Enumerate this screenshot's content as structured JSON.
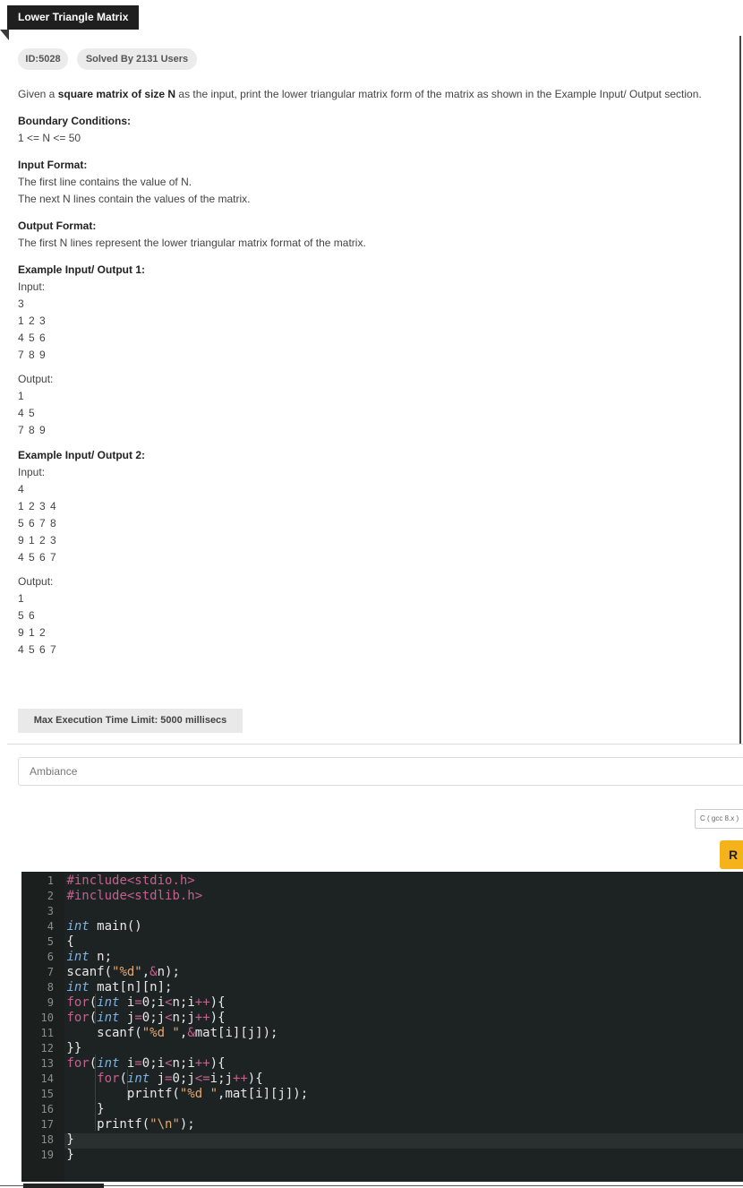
{
  "problem": {
    "title": "Lower Triangle Matrix",
    "id_badge": "ID:5028",
    "solved_badge": "Solved By 2131 Users",
    "desc_before": "Given a square matrix of size N as the input, print the lower triangular matrix form of the matrix as shown in the Example Input/ Output section.",
    "desc_prefix": "Given a ",
    "desc_bold": "square matrix of size N",
    "desc_suffix": " as the input, print the lower triangular matrix form of the matrix as shown in the Example Input/ Output section.",
    "boundary_heading": "Boundary Conditions:",
    "boundary_text": "1 <= N <= 50",
    "input_heading": "Input Format:",
    "input_line1": "The first line contains the value of N.",
    "input_line2": "The next N lines contain the values of the matrix.",
    "output_heading": "Output Format:",
    "output_line1": "The first N lines represent the lower triangular matrix format of the matrix.",
    "example1_heading": "Example Input/ Output 1:",
    "example2_heading": "Example Input/ Output 2:",
    "input_label": "Input:",
    "output_label": "Output:",
    "example1_input": [
      "3",
      "1 2 3",
      "4 5 6",
      "7 8 9"
    ],
    "example1_output": [
      "1",
      "4 5",
      "7 8 9"
    ],
    "example2_input": [
      "4",
      "1 2 3 4",
      "5 6 7 8",
      "9 1 2 3",
      "4 5 6 7"
    ],
    "example2_output": [
      "1",
      "5 6",
      "9 1 2",
      "4 5 6 7"
    ],
    "exec_limit": "Max Execution Time Limit: 5000 millisecs"
  },
  "editor": {
    "theme": "Ambiance",
    "language": "C ( gcc 8.x )",
    "run_label": "R",
    "colors": {
      "bg": "#1d2322",
      "keyword": "#7fb2e0",
      "control": "#c6608f",
      "string": "#e6a86f",
      "accent": "#f5b21a"
    },
    "lines": [
      {
        "n": "1",
        "code": "#include<stdio.h>"
      },
      {
        "n": "2",
        "code": "#include<stdlib.h>"
      },
      {
        "n": "3",
        "code": ""
      },
      {
        "n": "4",
        "code": "int main()"
      },
      {
        "n": "5",
        "code": "{"
      },
      {
        "n": "6",
        "code": "int n;"
      },
      {
        "n": "7",
        "code": "scanf(\"%d\",&n);"
      },
      {
        "n": "8",
        "code": "int mat[n][n];"
      },
      {
        "n": "9",
        "code": "for(int i=0;i<n;i++){"
      },
      {
        "n": "10",
        "code": "for(int j=0;j<n;j++){"
      },
      {
        "n": "11",
        "code": "    scanf(\"%d \",&mat[i][j]);"
      },
      {
        "n": "12",
        "code": "}}"
      },
      {
        "n": "13",
        "code": "for(int i=0;i<n;i++){"
      },
      {
        "n": "14",
        "code": "    for(int j=0;j<=i;j++){"
      },
      {
        "n": "15",
        "code": "        printf(\"%d \",mat[i][j]);"
      },
      {
        "n": "16",
        "code": "    }"
      },
      {
        "n": "17",
        "code": "    printf(\"\\n\");"
      },
      {
        "n": "18",
        "code": "}"
      },
      {
        "n": "19",
        "code": "}"
      }
    ]
  }
}
